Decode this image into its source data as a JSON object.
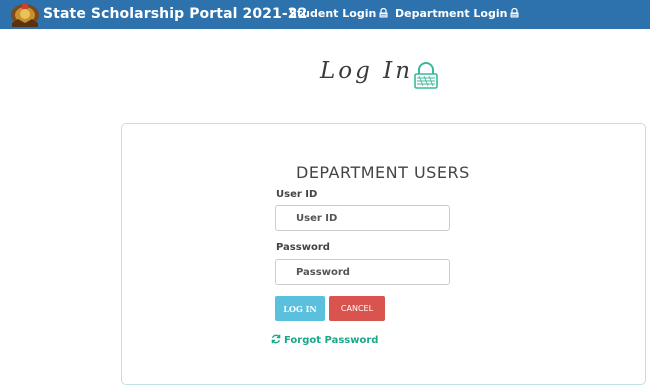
{
  "header": {
    "brand": "State Scholarship Portal 2021-22",
    "nav": [
      {
        "label": "Student Login",
        "icon": "lock-icon"
      },
      {
        "label": "Department Login",
        "icon": "lock-icon"
      }
    ]
  },
  "login_heading": "Log In",
  "form": {
    "title": "DEPARTMENT USERS",
    "userid_label": "User ID",
    "userid_placeholder": "User ID",
    "password_label": "Password",
    "password_placeholder": "Password",
    "login_button": "LOG IN",
    "cancel_button": "CANCEL",
    "forgot_password": "Forgot Password"
  },
  "colors": {
    "navbar": "#2d72ad",
    "login_button": "#5bc0de",
    "cancel_button": "#d9534f",
    "forgot_link": "#19a88a",
    "lock_accent": "#3bb89a"
  }
}
